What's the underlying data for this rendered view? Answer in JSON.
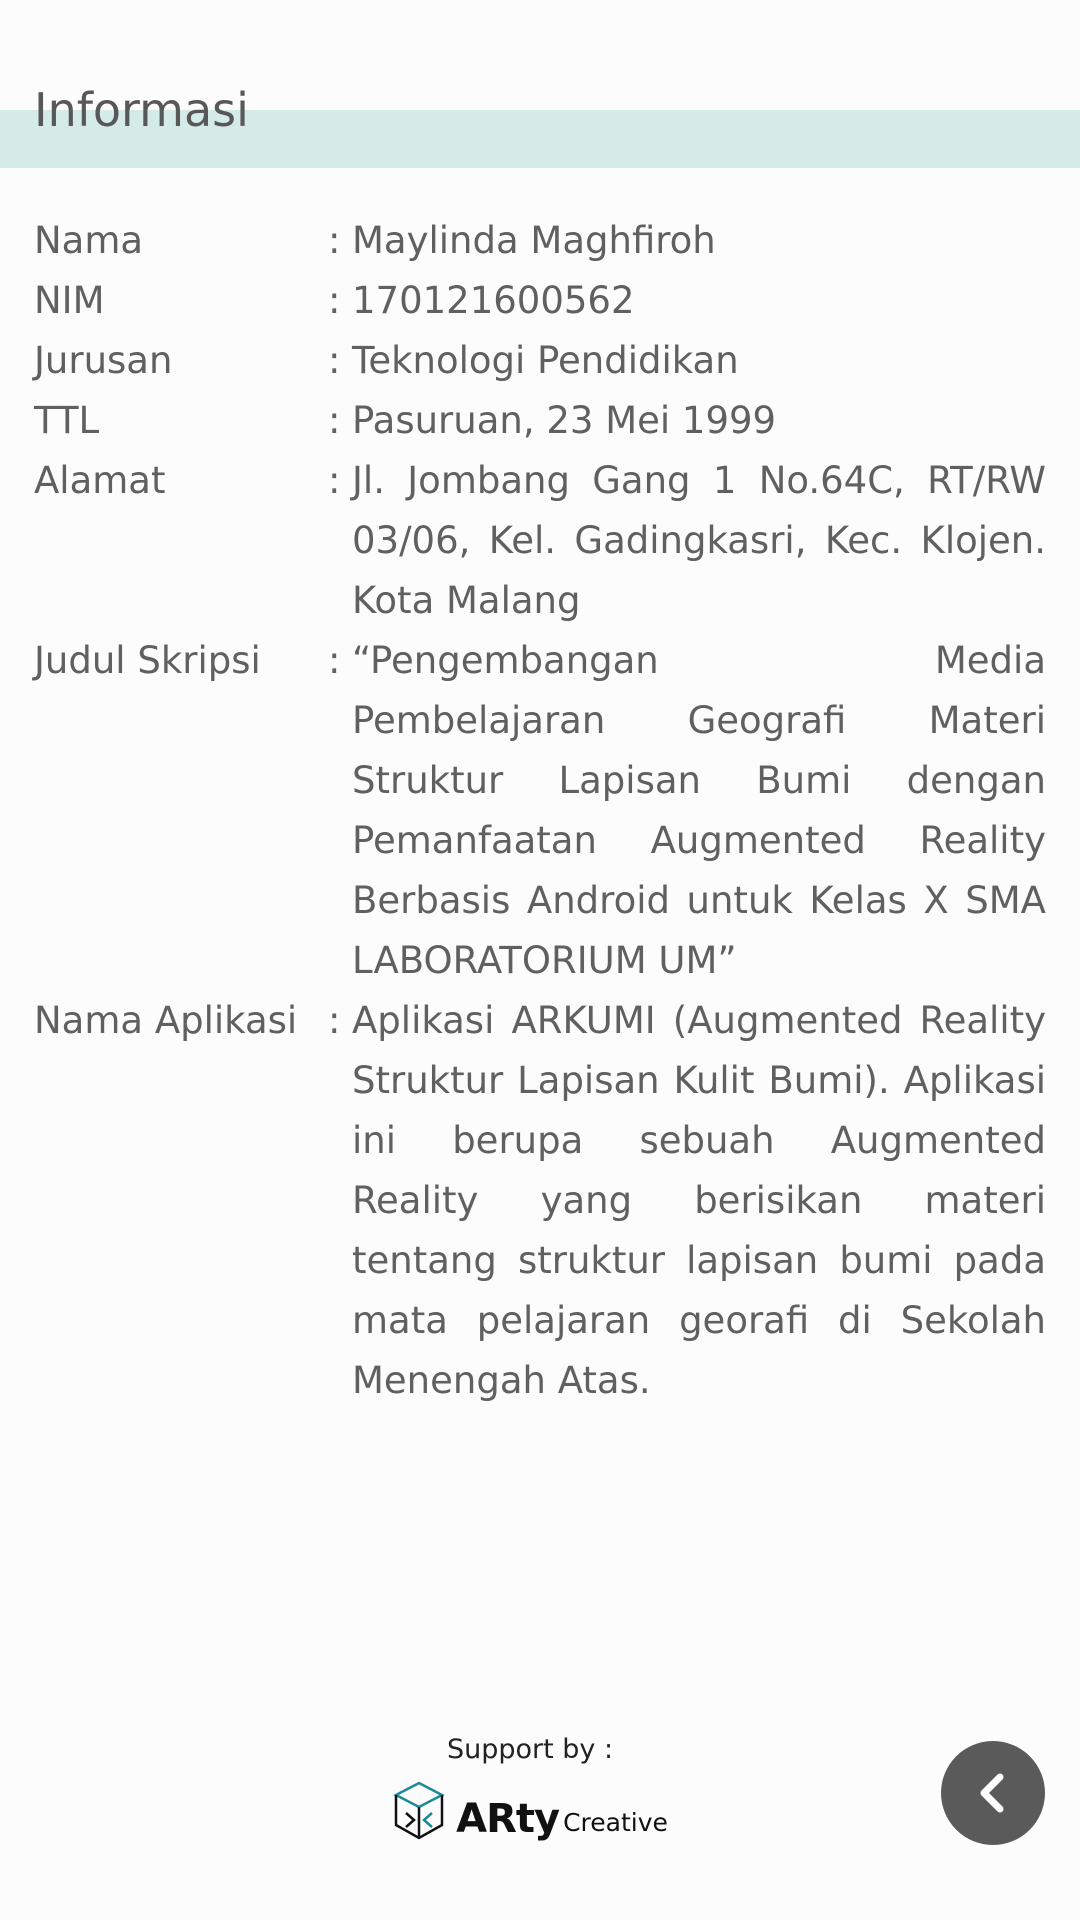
{
  "header": {
    "title": "Informasi"
  },
  "info": {
    "rows": [
      {
        "label": "Nama",
        "colon": ":",
        "value": "Maylinda Maghfiroh"
      },
      {
        "label": "NIM",
        "colon": ":",
        "value": "170121600562"
      },
      {
        "label": "Jurusan",
        "colon": ":",
        "value": "Teknologi Pendidikan"
      },
      {
        "label": "TTL",
        "colon": ":",
        "value": "Pasuruan, 23 Mei 1999"
      },
      {
        "label": "Alamat",
        "colon": ":",
        "value": "Jl. Jombang Gang 1 No.64C, RT/RW 03/06, Kel. Gadingkasri, Kec. Klojen. Kota Malang"
      },
      {
        "label": "Judul Skripsi",
        "colon": ":",
        "value": "“Pengembangan Media Pembelajaran Geografi Materi Struktur Lapisan Bumi dengan Pemanfaatan Augmented Reality Berbasis Android untuk Kelas X SMA LABORATORIUM UM”"
      },
      {
        "label": "Nama Aplikasi",
        "colon": ":",
        "value": "Aplikasi ARKUMI (Augmented Reality Struktur Lapisan Kulit Bumi). Aplikasi ini berupa sebuah Augmented Reality yang berisikan materi tentang struktur lapisan bumi pada mata pelajaran georafi di Sekolah Menengah Atas."
      }
    ]
  },
  "footer": {
    "support_label": "Support by :",
    "logo_main": "ARty",
    "logo_sub": "Creative",
    "back_icon": "chevron-left-icon"
  },
  "colors": {
    "header_band": "#d4ebe7",
    "text": "#606060",
    "back_button": "#5a5a5a"
  }
}
